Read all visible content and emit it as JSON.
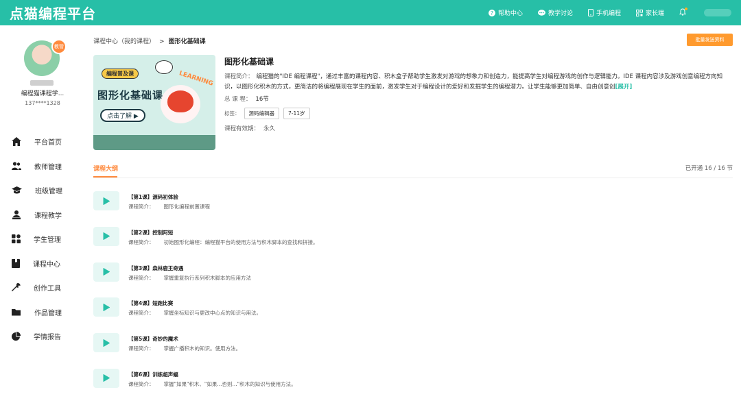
{
  "app": {
    "logo": "点猫编程平台"
  },
  "topnav": {
    "help": "帮助中心",
    "discussion": "教学讨论",
    "mobile": "手机编程",
    "parent": "家长端"
  },
  "user": {
    "badge": "教管",
    "name": "编程猫课程学...",
    "phone": "137****1328"
  },
  "sidebar": {
    "items": [
      {
        "label": "平台首页",
        "icon": "home-icon"
      },
      {
        "label": "教师管理",
        "icon": "teachers-icon"
      },
      {
        "label": "班级管理",
        "icon": "class-cap-icon"
      },
      {
        "label": "课程教学",
        "icon": "teacher-desk-icon"
      },
      {
        "label": "学生管理",
        "icon": "students-grid-icon"
      },
      {
        "label": "课程中心",
        "icon": "book-icon"
      },
      {
        "label": "创作工具",
        "icon": "wrench-icon"
      },
      {
        "label": "作品管理",
        "icon": "folder-icon"
      },
      {
        "label": "学情报告",
        "icon": "pie-chart-icon"
      }
    ]
  },
  "breadcrumb": {
    "parent": "课程中心（我的课程）",
    "sep": ">",
    "current": "图形化基础课"
  },
  "actions": {
    "send_materials": "批量发送资料"
  },
  "cover": {
    "tag": "编程普及课",
    "title": "图形化基础课",
    "button": "点击了解",
    "learning": "LEARNING"
  },
  "course": {
    "title": "图形化基础课",
    "desc_label": "课程简介：",
    "desc": "编程猫的\"IDE 编程课程\"，通过丰富的课程内容、积木盒子帮助学生激发对游戏的想象力和创造力，能提高学生对编程游戏的创作与逻辑能力。IDE 课程内容涉及游戏创意编程方向知识，以图形化积木的方式，更简洁的将编程展现在学生的面前，激发学生对于编程设计的爱好和发掘学生的编程潜力。让学生能够更加简单、自由创意创",
    "expand": "[展开]",
    "count_label": "总 课 程：",
    "count": "16节",
    "tags_label": "标签：",
    "tags": [
      "源码编辑器",
      "7-11岁"
    ],
    "validity_label": "课程有效期：",
    "validity": "永久"
  },
  "outline": {
    "tab": "课程大纲",
    "opened": "已开通 16 / 16 节",
    "lesson_desc_label": "课程简介：",
    "lessons": [
      {
        "title": "【第1课】源码初体验",
        "desc": "图形化编程前置课程"
      },
      {
        "title": "【第2课】控制阿短",
        "desc": "初始图形化编程：编程猫平台的使用方法与积木脚本的查找和拼接。"
      },
      {
        "title": "【第3课】森林鹿王奇遇",
        "desc": "掌握重复执行系列积木脚本的应用方法"
      },
      {
        "title": "【第4课】短跑比赛",
        "desc": "掌握坐标知识与更改中心点的知识与用法。"
      },
      {
        "title": "【第5课】奇妙的魔术",
        "desc": "掌握广播积木的知识。使用方法。"
      },
      {
        "title": "【第6课】训练超声蝠",
        "desc": "掌握\"如果\"积木、\"如果...否则...\"积木的知识与使用方法。"
      }
    ]
  },
  "colors": {
    "brand": "#27bfa7",
    "accent": "#ff8a3d",
    "button": "#ff9a2e"
  }
}
